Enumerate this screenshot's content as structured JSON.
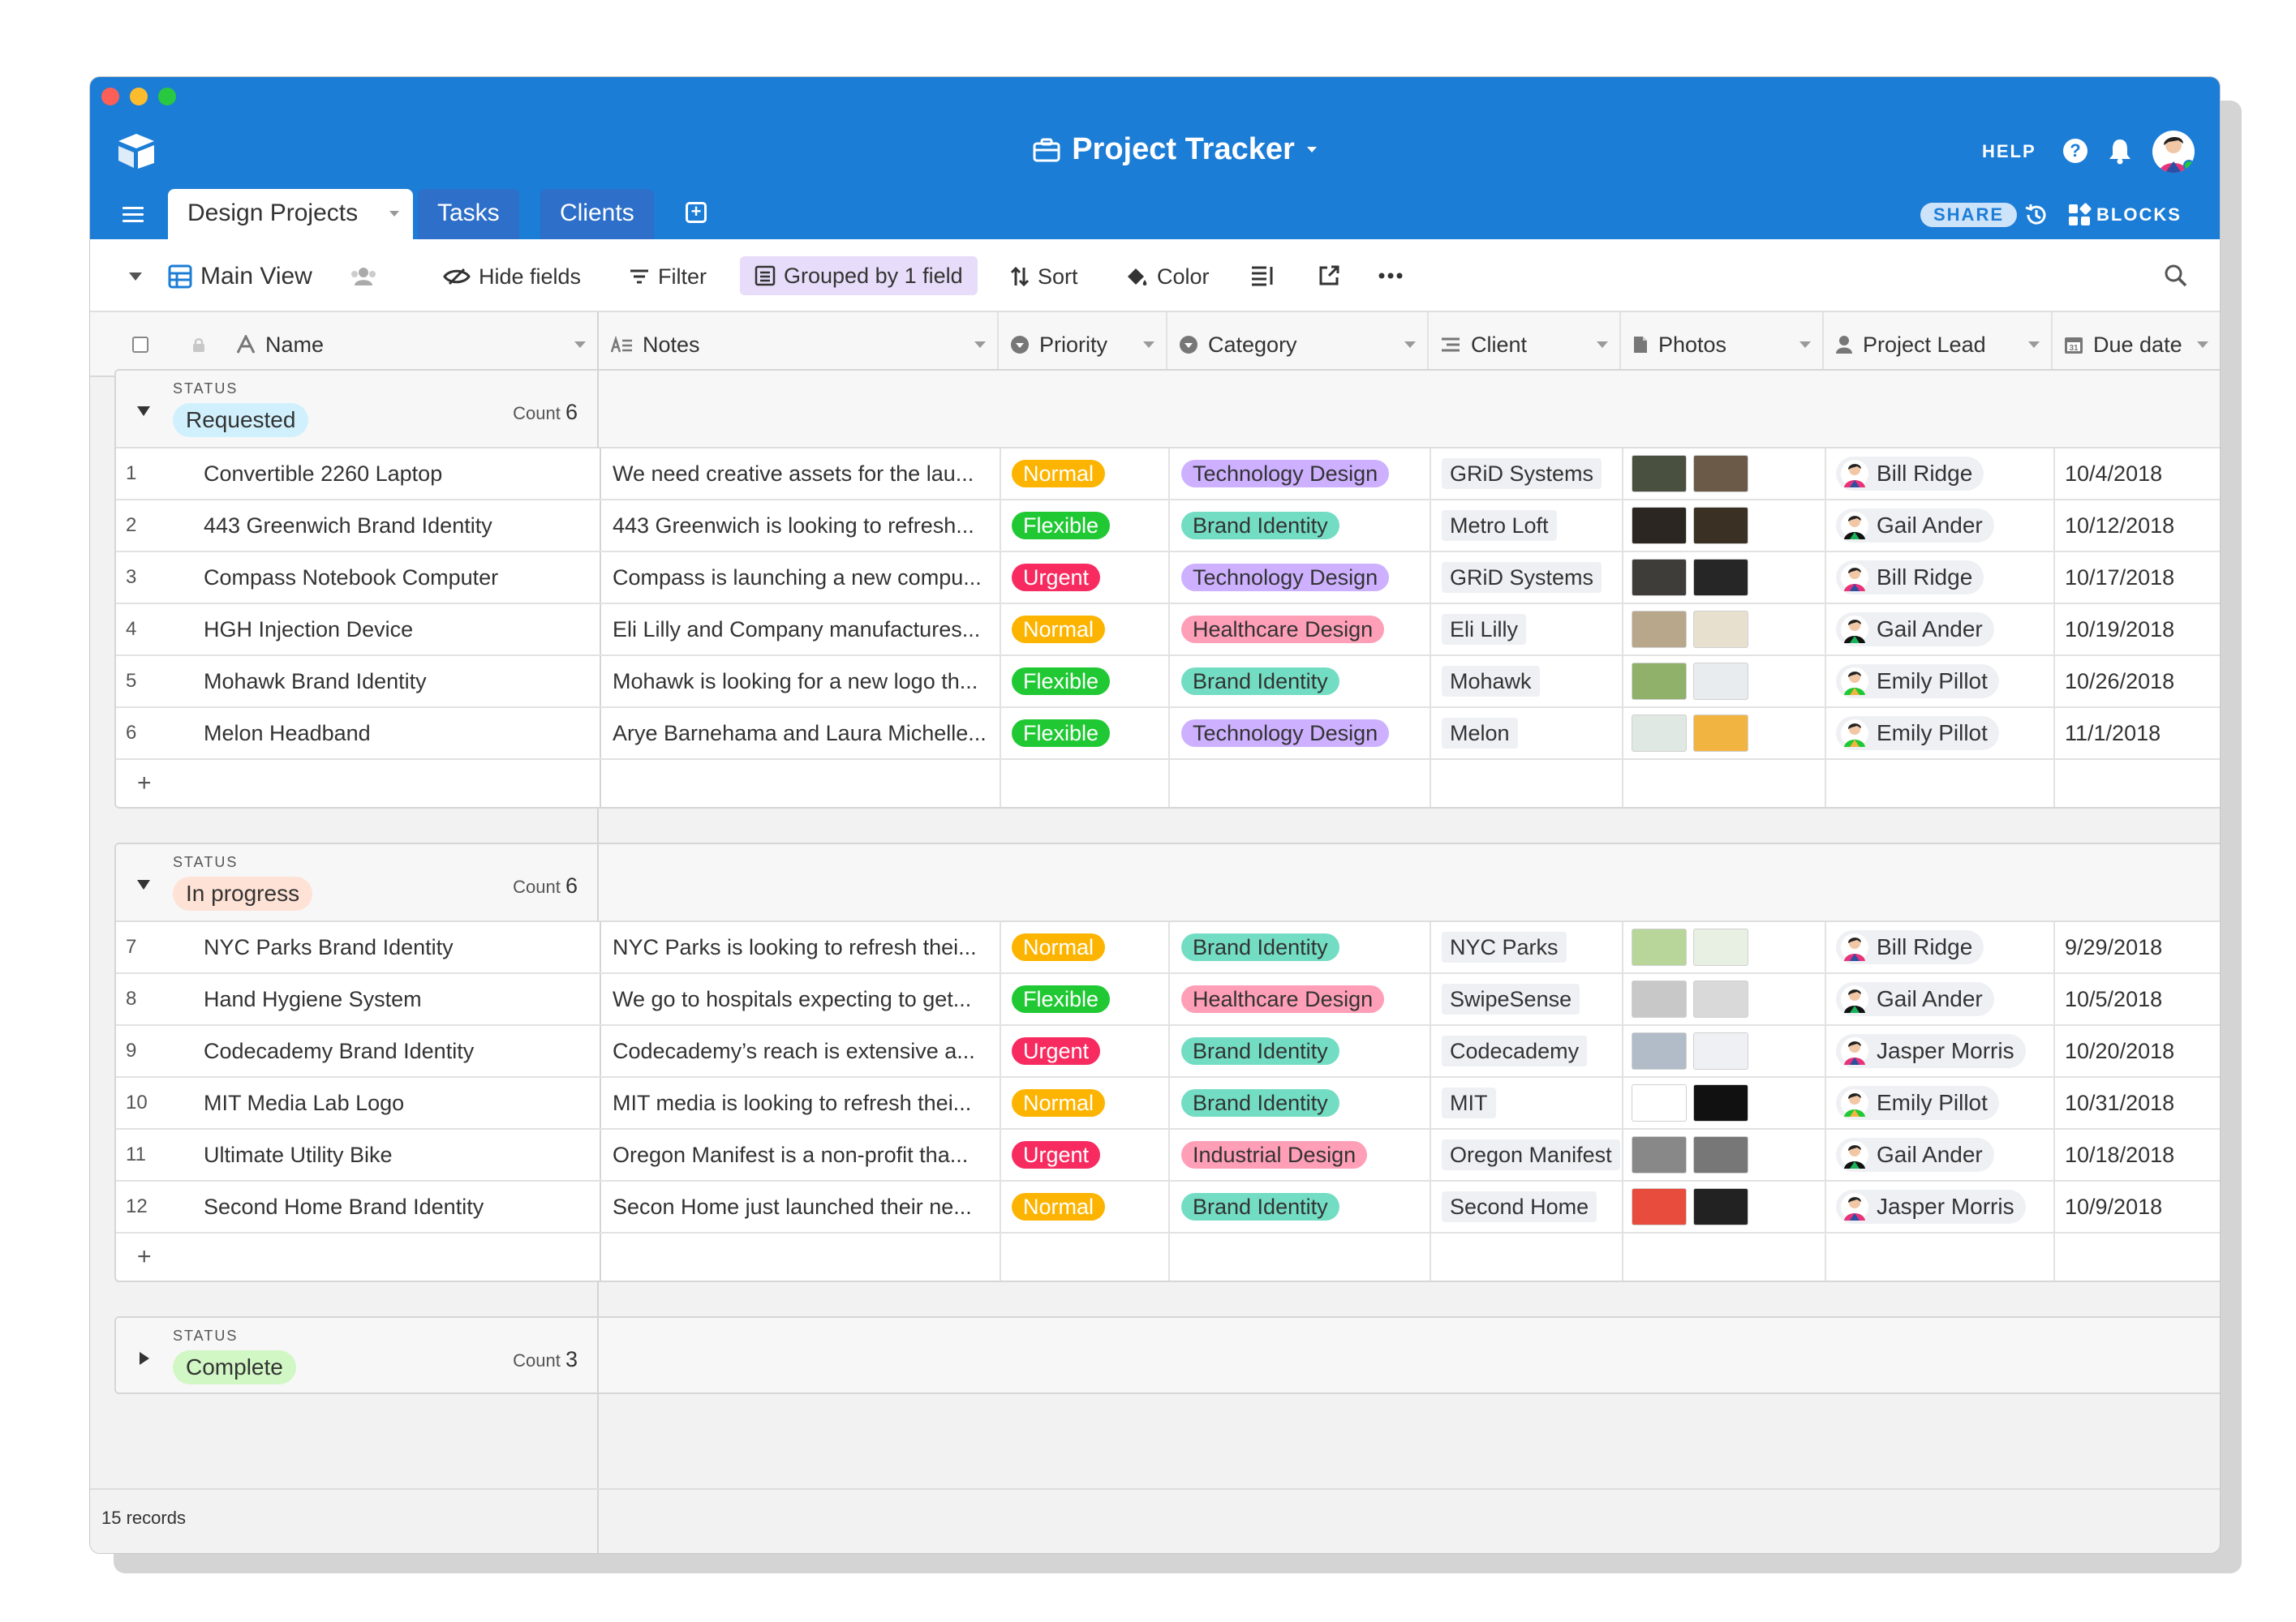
{
  "app": {
    "title": "Project Tracker",
    "help_label": "HELP",
    "share_label": "SHARE",
    "blocks_label": "BLOCKS"
  },
  "tabs": [
    {
      "label": "Design Projects",
      "active": true
    },
    {
      "label": "Tasks",
      "active": false
    },
    {
      "label": "Clients",
      "active": false
    }
  ],
  "toolbar": {
    "view_name": "Main View",
    "hide_fields": "Hide fields",
    "filter": "Filter",
    "grouped": "Grouped by 1 field",
    "sort": "Sort",
    "color": "Color"
  },
  "columns": [
    "Name",
    "Notes",
    "Priority",
    "Category",
    "Client",
    "Photos",
    "Project Lead",
    "Due date"
  ],
  "colors": {
    "brand_blue": "#1c7dd6",
    "priority": {
      "Normal": "#fcb400",
      "Flexible": "#20c933",
      "Urgent": "#f82b60"
    },
    "category": {
      "Technology Design": "#cdb0ff",
      "Brand Identity": "#72ddc3",
      "Healthcare Design": "#ff9eb7",
      "Industrial Design": "#ff9eb7"
    },
    "status": {
      "Requested": "#d0f0fd",
      "In progress": "#fee2d5",
      "Complete": "#d1f7c4"
    }
  },
  "groups": [
    {
      "status_label": "STATUS",
      "status": "Requested",
      "count_label": "Count",
      "count": "6",
      "expanded": true,
      "rows": [
        {
          "idx": "1",
          "name": "Convertible 2260 Laptop",
          "notes": "We need creative assets for the lau...",
          "priority": "Normal",
          "category": "Technology Design",
          "client": "GRiD Systems",
          "lead": "Bill Ridge",
          "due": "10/4/2018"
        },
        {
          "idx": "2",
          "name": "443 Greenwich Brand Identity",
          "notes": "443 Greenwich is looking to refresh...",
          "priority": "Flexible",
          "category": "Brand Identity",
          "client": "Metro Loft",
          "lead": "Gail Ander",
          "due": "10/12/2018"
        },
        {
          "idx": "3",
          "name": "Compass Notebook Computer",
          "notes": "Compass is launching a new compu...",
          "priority": "Urgent",
          "category": "Technology Design",
          "client": "GRiD Systems",
          "lead": "Bill Ridge",
          "due": "10/17/2018"
        },
        {
          "idx": "4",
          "name": "HGH Injection Device",
          "notes": "Eli Lilly and Company manufactures...",
          "priority": "Normal",
          "category": "Healthcare Design",
          "client": "Eli Lilly",
          "lead": "Gail Ander",
          "due": "10/19/2018"
        },
        {
          "idx": "5",
          "name": "Mohawk Brand Identity",
          "notes": "Mohawk is looking for a new logo th...",
          "priority": "Flexible",
          "category": "Brand Identity",
          "client": "Mohawk",
          "lead": "Emily Pillot",
          "due": "10/26/2018"
        },
        {
          "idx": "6",
          "name": "Melon Headband",
          "notes": "Arye Barnehama and Laura Michelle...",
          "priority": "Flexible",
          "category": "Technology Design",
          "client": "Melon",
          "lead": "Emily Pillot",
          "due": "11/1/2018"
        }
      ]
    },
    {
      "status_label": "STATUS",
      "status": "In progress",
      "count_label": "Count",
      "count": "6",
      "expanded": true,
      "rows": [
        {
          "idx": "7",
          "name": "NYC Parks Brand Identity",
          "notes": "NYC Parks is looking to refresh thei...",
          "priority": "Normal",
          "category": "Brand Identity",
          "client": "NYC Parks",
          "lead": "Bill Ridge",
          "due": "9/29/2018"
        },
        {
          "idx": "8",
          "name": "Hand Hygiene System",
          "notes": "We go to hospitals expecting to get...",
          "priority": "Flexible",
          "category": "Healthcare Design",
          "client": "SwipeSense",
          "lead": "Gail Ander",
          "due": "10/5/2018"
        },
        {
          "idx": "9",
          "name": "Codecademy Brand Identity",
          "notes": "Codecademy’s reach is extensive a...",
          "priority": "Urgent",
          "category": "Brand Identity",
          "client": "Codecademy",
          "lead": "Jasper Morris",
          "due": "10/20/2018"
        },
        {
          "idx": "10",
          "name": "MIT Media Lab Logo",
          "notes": "MIT media is looking to refresh thei...",
          "priority": "Normal",
          "category": "Brand Identity",
          "client": "MIT",
          "lead": "Emily Pillot",
          "due": "10/31/2018"
        },
        {
          "idx": "11",
          "name": "Ultimate Utility Bike",
          "notes": "Oregon Manifest is a non-profit tha...",
          "priority": "Urgent",
          "category": "Industrial Design",
          "client": "Oregon Manifest",
          "lead": "Gail Ander",
          "due": "10/18/2018"
        },
        {
          "idx": "12",
          "name": "Second Home Brand Identity",
          "notes": "Secon Home just launched their ne...",
          "priority": "Normal",
          "category": "Brand Identity",
          "client": "Second Home",
          "lead": "Jasper Morris",
          "due": "10/9/2018"
        }
      ]
    },
    {
      "status_label": "STATUS",
      "status": "Complete",
      "count_label": "Count",
      "count": "3",
      "expanded": false,
      "rows": []
    }
  ],
  "footer": {
    "records": "15 records"
  }
}
